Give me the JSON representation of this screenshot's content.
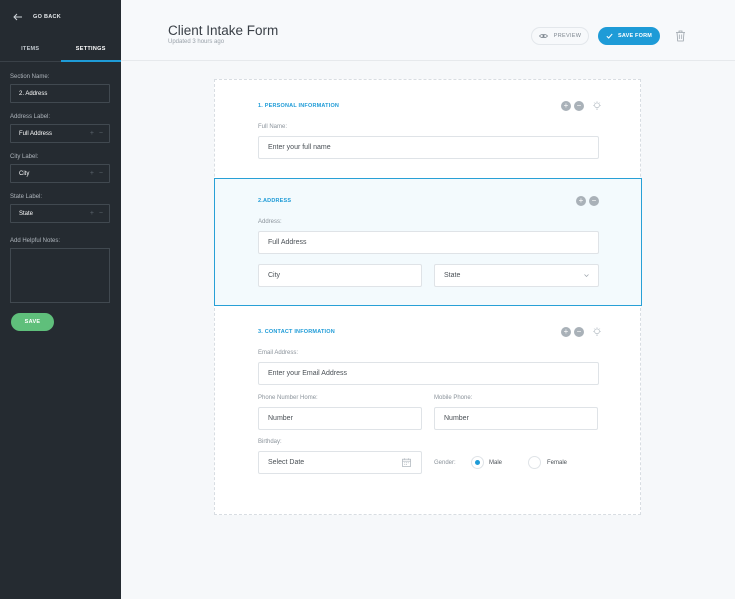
{
  "sidebar": {
    "go_back": "GO BACK",
    "tabs": [
      {
        "label": "ITEMS"
      },
      {
        "label": "SETTINGS",
        "active": true
      }
    ],
    "fields": {
      "section_name": {
        "label": "Section Name:",
        "value": "2. Address"
      },
      "address_label": {
        "label": "Address Label:",
        "value": "Full Address"
      },
      "city_label": {
        "label": "City Label:",
        "value": "City"
      },
      "state_label": {
        "label": "State Label:",
        "value": "State"
      },
      "helpful_notes": {
        "label": "Add Helpful Notes:",
        "value": ""
      }
    },
    "save_label": "SAVE",
    "stepper_plus": "+",
    "stepper_minus": "−"
  },
  "header": {
    "title": "Client Intake Form",
    "subtitle": "Updated 3 hours ago",
    "preview_label": "PREVIEW",
    "save_form_label": "SAVE FORM"
  },
  "form": {
    "sections": [
      {
        "title": "1. PERSONAL INFORMATION",
        "fields": {
          "full_name": {
            "label": "Full Name:",
            "placeholder": "Enter your full name"
          }
        }
      },
      {
        "title": "2.ADDRESS",
        "fields": {
          "address": {
            "label": "Address:",
            "placeholder": "Full Address"
          },
          "city": {
            "placeholder": "City"
          },
          "state": {
            "value": "State"
          }
        }
      },
      {
        "title": "3. CONTACT INFORMATION",
        "fields": {
          "email": {
            "label": "Email Address:",
            "placeholder": "Enter your Email Address"
          },
          "phone_home": {
            "label": "Phone Number Home:",
            "placeholder": "Number"
          },
          "mobile_phone": {
            "label": "Mobile Phone:",
            "placeholder": "Number"
          },
          "birthday": {
            "label": "Birthday:",
            "placeholder": "Select Date"
          },
          "gender": {
            "label": "Gender:",
            "options": [
              "Male",
              "Female"
            ],
            "selected": "Male"
          }
        }
      }
    ],
    "ctrl_plus": "+",
    "ctrl_minus": "−"
  },
  "colors": {
    "accent": "#1e9bd7",
    "success": "#5fbf7b",
    "sidebar_bg": "#252b31",
    "selection_border": "#28a0d6"
  },
  "icons": [
    "back-arrow-icon",
    "eye-icon",
    "check-icon",
    "trash-icon",
    "lightbulb-icon",
    "chevron-down-icon",
    "calendar-icon",
    "plus-circle-icon",
    "minus-circle-icon"
  ]
}
